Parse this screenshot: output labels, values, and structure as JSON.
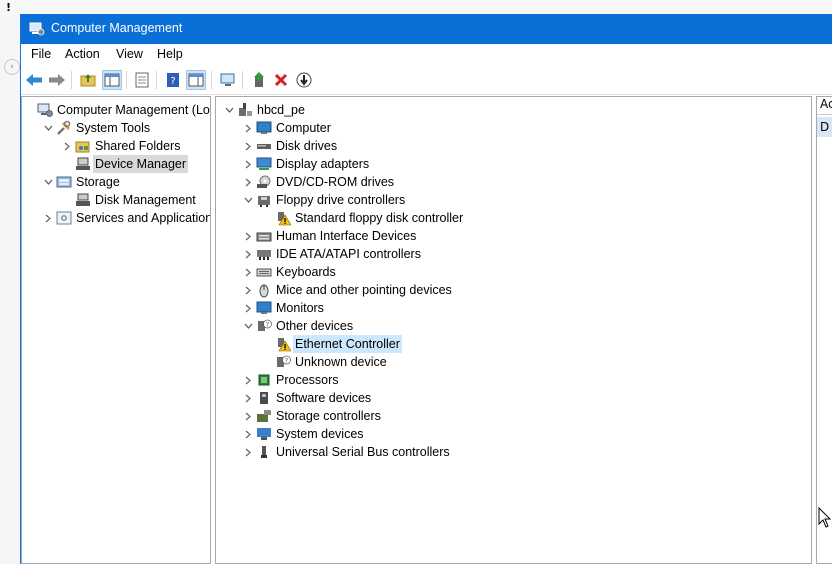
{
  "window": {
    "title": "Computer Management"
  },
  "desktop": {
    "warning_glyph": "!"
  },
  "menu": [
    "File",
    "Action",
    "View",
    "Help"
  ],
  "toolbar_icons": [
    "back-icon",
    "forward-icon",
    "up-folder-icon",
    "show-hide-tree-icon",
    "properties-icon",
    "help-icon",
    "action-pane-icon",
    "scan-hardware-icon",
    "update-driver-icon",
    "uninstall-icon",
    "disable-icon"
  ],
  "left_tree": [
    {
      "label": "Computer Management (Local",
      "expander": "",
      "indent": 0,
      "icon": "computer-management-icon"
    },
    {
      "label": "System Tools",
      "expander": "v",
      "indent": 1,
      "icon": "system-tools-icon"
    },
    {
      "label": "Shared Folders",
      "expander": ">",
      "indent": 2,
      "icon": "shared-folders-icon"
    },
    {
      "label": "Device Manager",
      "expander": "",
      "indent": 2,
      "icon": "device-manager-icon",
      "selected": true
    },
    {
      "label": "Storage",
      "expander": "v",
      "indent": 1,
      "icon": "storage-icon"
    },
    {
      "label": "Disk Management",
      "expander": "",
      "indent": 2,
      "icon": "disk-management-icon"
    },
    {
      "label": "Services and Applications",
      "expander": ">",
      "indent": 1,
      "icon": "services-icon"
    }
  ],
  "device_tree": [
    {
      "label": "hbcd_pe",
      "expander": "v",
      "indent": 0,
      "icon": "pc-icon"
    },
    {
      "label": "Computer",
      "expander": ">",
      "indent": 1,
      "icon": "monitor-icon"
    },
    {
      "label": "Disk drives",
      "expander": ">",
      "indent": 1,
      "icon": "disk-drive-icon"
    },
    {
      "label": "Display adapters",
      "expander": ">",
      "indent": 1,
      "icon": "display-adapter-icon"
    },
    {
      "label": "DVD/CD-ROM drives",
      "expander": ">",
      "indent": 1,
      "icon": "dvd-icon"
    },
    {
      "label": "Floppy drive controllers",
      "expander": "v",
      "indent": 1,
      "icon": "floppy-controller-icon"
    },
    {
      "label": "Standard floppy disk controller",
      "expander": "",
      "indent": 2,
      "icon": "warning-device-icon"
    },
    {
      "label": "Human Interface Devices",
      "expander": ">",
      "indent": 1,
      "icon": "hid-icon"
    },
    {
      "label": "IDE ATA/ATAPI controllers",
      "expander": ">",
      "indent": 1,
      "icon": "ide-icon"
    },
    {
      "label": "Keyboards",
      "expander": ">",
      "indent": 1,
      "icon": "keyboard-icon"
    },
    {
      "label": "Mice and other pointing devices",
      "expander": ">",
      "indent": 1,
      "icon": "mouse-icon"
    },
    {
      "label": "Monitors",
      "expander": ">",
      "indent": 1,
      "icon": "monitor-icon"
    },
    {
      "label": "Other devices",
      "expander": "v",
      "indent": 1,
      "icon": "unknown-device-icon"
    },
    {
      "label": "Ethernet Controller",
      "expander": "",
      "indent": 2,
      "icon": "warning-device-icon",
      "highlight": true
    },
    {
      "label": "Unknown device",
      "expander": "",
      "indent": 2,
      "icon": "unknown-device-icon"
    },
    {
      "label": "Processors",
      "expander": ">",
      "indent": 1,
      "icon": "processor-icon"
    },
    {
      "label": "Software devices",
      "expander": ">",
      "indent": 1,
      "icon": "software-device-icon"
    },
    {
      "label": "Storage controllers",
      "expander": ">",
      "indent": 1,
      "icon": "storage-controller-icon"
    },
    {
      "label": "System devices",
      "expander": ">",
      "indent": 1,
      "icon": "system-device-icon"
    },
    {
      "label": "Universal Serial Bus controllers",
      "expander": ">",
      "indent": 1,
      "icon": "usb-icon"
    }
  ],
  "actions_pane": {
    "header": "Ac",
    "item": "D"
  }
}
